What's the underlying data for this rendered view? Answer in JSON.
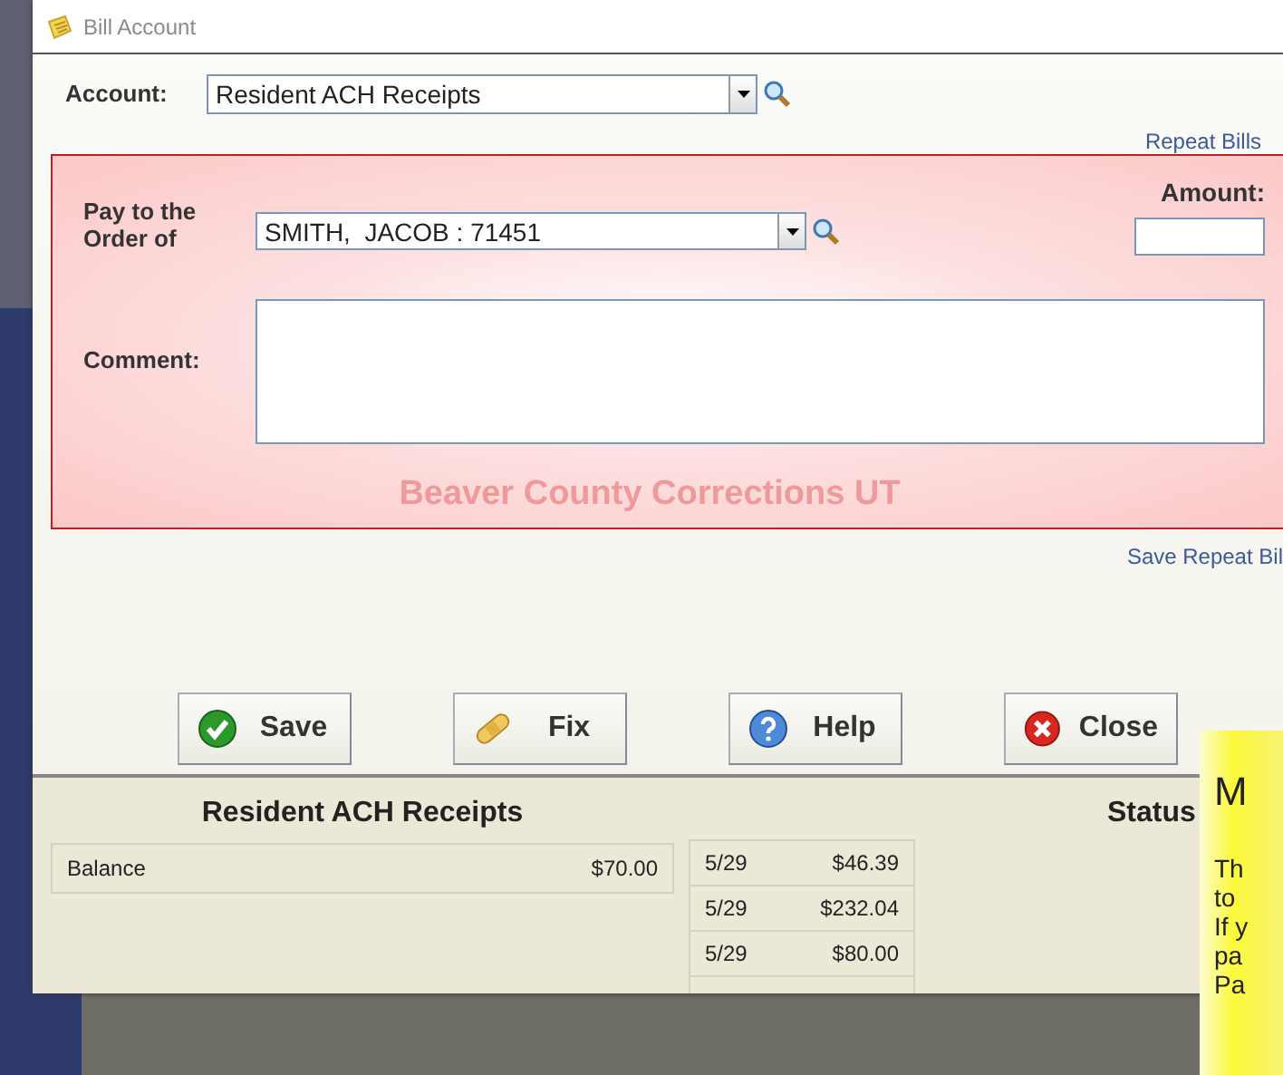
{
  "window": {
    "title": "Bill Account"
  },
  "account": {
    "label": "Account:",
    "value": "Resident ACH Receipts"
  },
  "repeat_bills_link": "Repeat Bills",
  "payee": {
    "label": "Pay to the Order of",
    "value": "SMITH,  JACOB : 71451"
  },
  "amount": {
    "label": "Amount:"
  },
  "comment": {
    "label": "Comment:"
  },
  "facility": "Beaver County Corrections UT",
  "save_repeat_link": "Save Repeat Bil",
  "buttons": [
    {
      "label": "Save",
      "kind": "save"
    },
    {
      "label": "Fix",
      "kind": "fix"
    },
    {
      "label": "Help",
      "kind": "help"
    },
    {
      "label": "Close",
      "kind": "close"
    }
  ],
  "summary": {
    "title": "Resident ACH Receipts",
    "balance": {
      "label": "Balance",
      "value": "$70.00"
    },
    "transactions": [
      {
        "date": "5/29",
        "amount": "$46.39"
      },
      {
        "date": "5/29",
        "amount": "$232.04"
      },
      {
        "date": "5/29",
        "amount": "$80.00"
      }
    ],
    "status_label": "Status"
  },
  "note": {
    "title": "M",
    "lines": [
      "Th",
      "to",
      "If y",
      "pa",
      "Pa"
    ]
  }
}
